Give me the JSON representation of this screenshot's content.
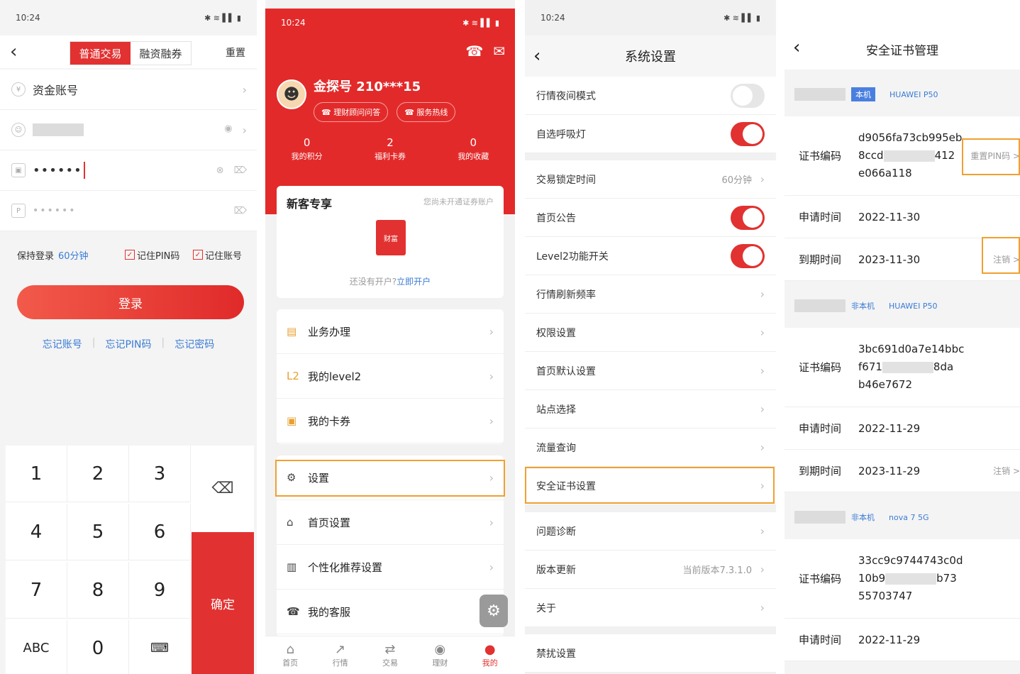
{
  "s1": {
    "status": {
      "time": "10:24",
      "right": "✱ ≋ ▌▌ ▮"
    },
    "tabs": [
      "普通交易",
      "融资融券"
    ],
    "reset": "重置",
    "rows": {
      "account_label": "资金账号",
      "password_mask": "••••••",
      "pin_mask": "••••••"
    },
    "keep_login_label": "保持登录",
    "keep_login_value": "60分钟",
    "remember_pin": "记住PIN码",
    "remember_account": "记住账号",
    "login": "登录",
    "links": [
      "忘记账号",
      "忘记PIN码",
      "忘记密码"
    ],
    "keys": [
      "1",
      "2",
      "3",
      "4",
      "5",
      "6",
      "7",
      "8",
      "9",
      "ABC",
      "0"
    ],
    "confirm": "确定"
  },
  "s2": {
    "status": {
      "time": "10:24",
      "right": "✱ ≋ ▌▌ ▮"
    },
    "username": "金探号 210***15",
    "pills": [
      "理财顾问问答",
      "服务热线"
    ],
    "stats": [
      {
        "n": "0",
        "l": "我的积分"
      },
      {
        "n": "2",
        "l": "福利卡券"
      },
      {
        "n": "0",
        "l": "我的收藏"
      }
    ],
    "newcard": {
      "title": "新客专享",
      "right": "您尚未开通证券账户",
      "pic": "财富",
      "bottom_prefix": "还没有开户?",
      "bottom_link": "立即开户"
    },
    "menu1": [
      {
        "icon": "▤",
        "label": "业务办理"
      },
      {
        "icon": "L2",
        "label": "我的level2"
      },
      {
        "icon": "▣",
        "label": "我的卡券"
      }
    ],
    "menu2": [
      {
        "icon": "⚙",
        "label": "设置"
      },
      {
        "icon": "⌂",
        "label": "首页设置"
      },
      {
        "icon": "▥",
        "label": "个性化推荐设置"
      },
      {
        "icon": "☎",
        "label": "我的客服"
      }
    ],
    "tabbar": [
      {
        "icon": "⌂",
        "label": "首页"
      },
      {
        "icon": "↗",
        "label": "行情"
      },
      {
        "icon": "⇄",
        "label": "交易"
      },
      {
        "icon": "◉",
        "label": "理财"
      },
      {
        "icon": "●",
        "label": "我的"
      }
    ],
    "colors": {
      "brand": "#e32a2a",
      "highlight": "#f0a030"
    }
  },
  "s3": {
    "status": {
      "time": "10:24",
      "right": "✱ ≋ ▌▌ ▮"
    },
    "title": "系统设置",
    "night_mode": "行情夜间模式",
    "breathing_light": "自选呼吸灯",
    "lock_time": "交易锁定时间",
    "lock_time_value": "60分钟",
    "home_notice": "首页公告",
    "level2_switch": "Level2功能开关",
    "refresh_rate": "行情刷新频率",
    "permission": "权限设置",
    "home_default": "首页默认设置",
    "site_select": "站点选择",
    "traffic": "流量查询",
    "cert_settings": "安全证书设置",
    "diagnosis": "问题诊断",
    "version_update": "版本更新",
    "version_value": "当前版本7.3.1.0",
    "about": "关于",
    "dnd": "禁扰设置"
  },
  "s4": {
    "title": "安全证书管理",
    "labels": {
      "code": "证书编码",
      "apply": "申请时间",
      "expire": "到期时间"
    },
    "reset_pin": "重置PIN码 >",
    "cancel": "注销 >",
    "certs": [
      {
        "badge": "本机",
        "model": "HUAWEI P50",
        "code1": "d9056fa73cb995eb",
        "code2a": "8ccd",
        "code2b": "412",
        "code3": "e066a118",
        "apply": "2022-11-30",
        "expire": "2023-11-30"
      },
      {
        "badge": "非本机",
        "model": "HUAWEI P50",
        "code1": "3bc691d0a7e14bbc",
        "code2a": "f671",
        "code2b": "8da",
        "code3": "b46e7672",
        "apply": "2022-11-29",
        "expire": "2023-11-29"
      },
      {
        "badge": "非本机",
        "model": "nova 7 5G",
        "code1": "33cc9c9744743c0d",
        "code2a": "10b9",
        "code2b": "b73",
        "code3": "55703747",
        "apply": "2022-11-29"
      }
    ]
  }
}
